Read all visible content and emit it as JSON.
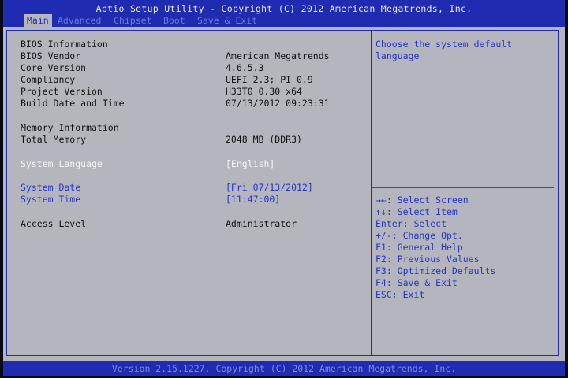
{
  "title": "Aptio Setup Utility - Copyright (C) 2012 American Megatrends, Inc.",
  "tabs": [
    "Main",
    "Advanced",
    "Chipset",
    "Boot",
    "Save & Exit"
  ],
  "bios_info": {
    "heading": "BIOS Information",
    "rows": [
      {
        "label": "BIOS Vendor",
        "value": "American Megatrends"
      },
      {
        "label": "Core Version",
        "value": "4.6.5.3"
      },
      {
        "label": "Compliancy",
        "value": "UEFI 2.3; PI 0.9"
      },
      {
        "label": "Project Version",
        "value": "H33T0 0.30 x64"
      },
      {
        "label": "Build Date and Time",
        "value": "07/13/2012 09:23:31"
      }
    ]
  },
  "memory_info": {
    "heading": "Memory Information",
    "rows": [
      {
        "label": "Total Memory",
        "value": "2048 MB (DDR3)"
      }
    ]
  },
  "settings": {
    "system_language": {
      "label": "System Language",
      "value": "[English]"
    },
    "system_date": {
      "label": "System Date",
      "value": "[Fri 07/13/2012]"
    },
    "system_time": {
      "label": "System Time",
      "value": "[11:47:00]"
    },
    "access_level": {
      "label": "Access Level",
      "value": "Administrator"
    }
  },
  "help": {
    "description": [
      "Choose the system default",
      "language"
    ],
    "keys": [
      "→←: Select Screen",
      "↑↓: Select Item",
      "Enter: Select",
      "+/-: Change Opt.",
      "F1: General Help",
      "F2: Previous Values",
      "F3: Optimized Defaults",
      "F4: Save & Exit",
      "ESC: Exit"
    ]
  },
  "footer": "Version 2.15.1227. Copyright (C) 2012 American Megatrends, Inc.",
  "colors": {
    "accent": "#1f2bb0",
    "background": "#b5b5bd",
    "highlight": "#f4f4f8",
    "link": "#2336c8"
  }
}
